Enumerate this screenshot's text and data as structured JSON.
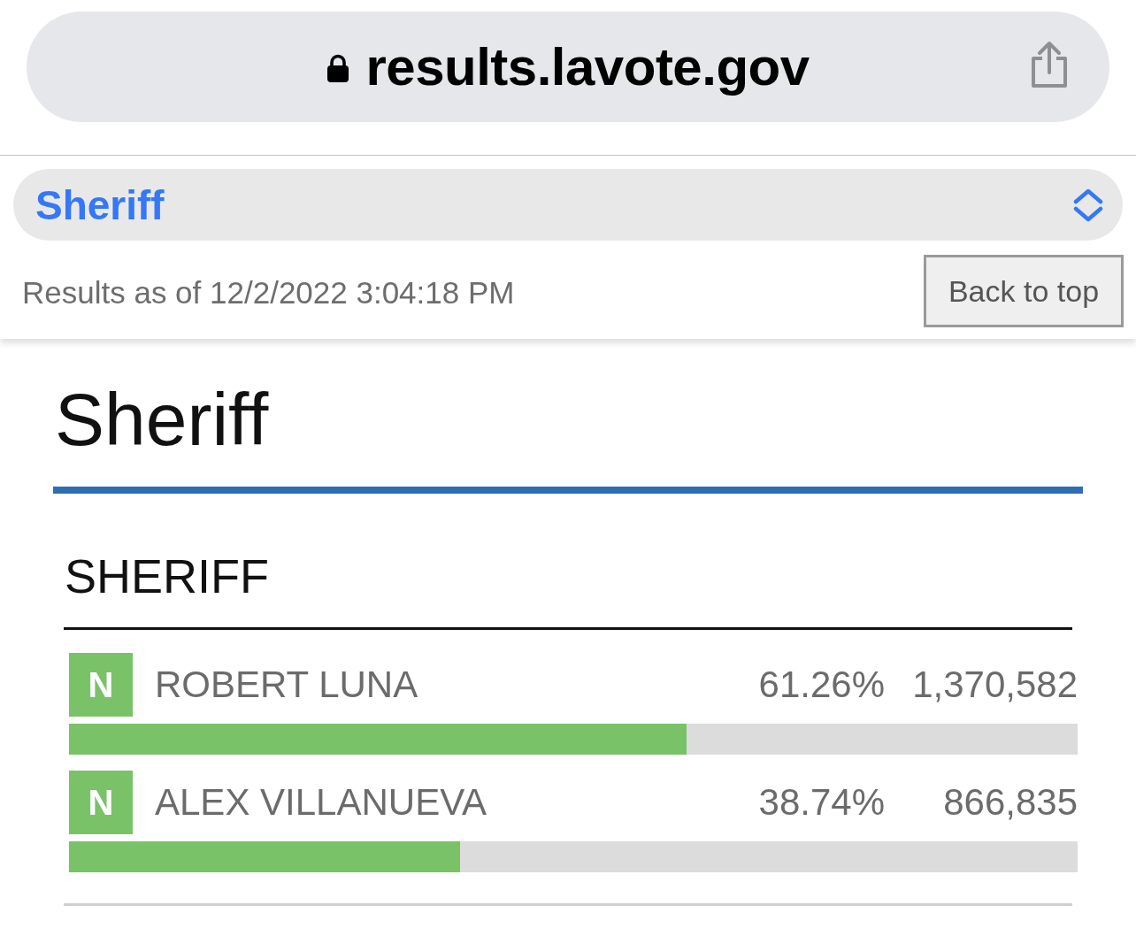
{
  "browser": {
    "url": "results.lavote.gov"
  },
  "contest_select": {
    "value": "Sheriff"
  },
  "results_time": "Results as of 12/2/2022 3:04:18 PM",
  "back_to_top": "Back to top",
  "page_title": "Sheriff",
  "contest": {
    "title": "SHERIFF",
    "candidates": [
      {
        "badge": "N",
        "name": "ROBERT LUNA",
        "percent": "61.26%",
        "votes": "1,370,582",
        "level": 0.6126
      },
      {
        "badge": "N",
        "name": "ALEX VILLANUEVA",
        "percent": "38.74%",
        "votes": "866,835",
        "level": 0.3874
      }
    ]
  }
}
